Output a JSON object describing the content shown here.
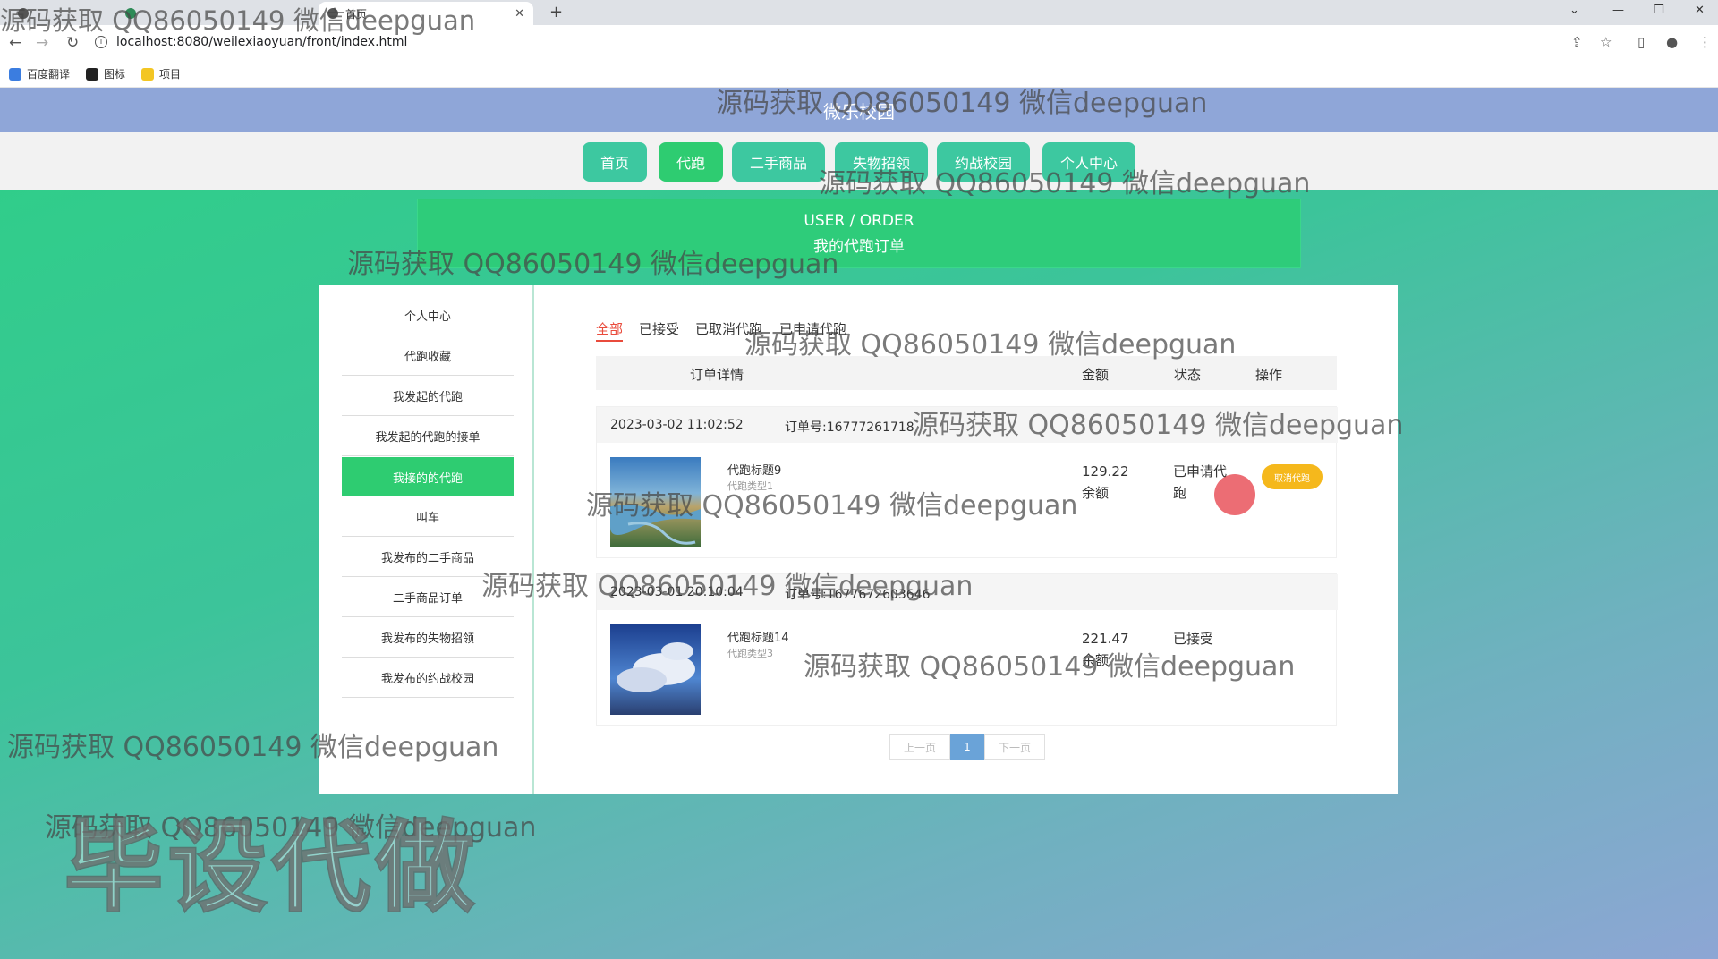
{
  "browser": {
    "tab_title": "首页",
    "url": "localhost:8080/weilexiaoyuan/front/index.html",
    "bookmarks": [
      "百度翻译",
      "图标",
      "项目"
    ]
  },
  "site": {
    "title": "微乐校园",
    "nav": [
      "首页",
      "代跑",
      "二手商品",
      "失物招领",
      "约战校园",
      "个人中心"
    ],
    "nav_active": "代跑"
  },
  "banner": {
    "en": "USER / ORDER",
    "zh": "我的代跑订单"
  },
  "sidebar": {
    "items": [
      "个人中心",
      "代跑收藏",
      "我发起的代跑",
      "我发起的代跑的接单",
      "我接的的代跑",
      "叫车",
      "我发布的二手商品",
      "二手商品订单",
      "我发布的失物招领",
      "我发布的约战校园"
    ],
    "active": "我接的的代跑"
  },
  "filters": [
    "全部",
    "已接受",
    "已取消代跑",
    "已申请代跑"
  ],
  "table_headers": {
    "detail": "订单详情",
    "amount": "金额",
    "status": "状态",
    "action": "操作"
  },
  "orders": [
    {
      "time": "2023-03-02 11:02:52",
      "order_no": "订单号:16777261718",
      "title": "代跑标题9",
      "type": "代跑类型1",
      "amount": "129.22",
      "pay": "余额",
      "status": "已申请代跑",
      "action": "取消代跑"
    },
    {
      "time": "2023-03-01 20:10:04",
      "order_no": "订单号:1677672603646",
      "title": "代跑标题14",
      "type": "代跑类型3",
      "amount": "221.47",
      "pay": "余额",
      "status": "已接受"
    }
  ],
  "pager": {
    "prev": "上一页",
    "current": "1",
    "next": "下一页"
  },
  "watermark": {
    "tab_overlay": "源码获取 QQ86050149 微信deepguan",
    "text": "源码获取 QQ86050149 微信deepguan",
    "big": "毕设代做"
  },
  "colors": {
    "header": "#8fa6d8",
    "accent": "#2ecc71",
    "cancel": "#f5b81c",
    "filter_active": "#e94b3c"
  }
}
